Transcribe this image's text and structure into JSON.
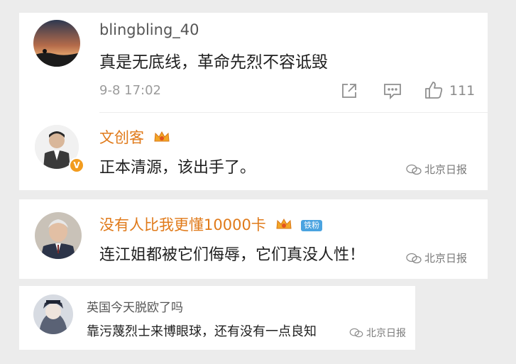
{
  "comments": [
    {
      "username": "blingbling_40",
      "text": "真是无底线，革命先烈不容诋毁",
      "time": "9-8 17:02",
      "likes": "111"
    },
    {
      "username": "文创客",
      "text": "正本清源，该出手了。",
      "verified_badge": "V"
    },
    {
      "username": "没有人比我更懂10000卡",
      "badge": "铁粉",
      "text": "连江姐都被它们侮辱，它们真没人性！"
    },
    {
      "username": "英国今天脱欧了吗",
      "text": "靠污蔑烈士来博眼球，还有没有一点良知"
    }
  ],
  "watermark": "北京日报",
  "icons": {
    "share": "share-icon",
    "comment": "comment-icon",
    "like": "thumbs-up-icon",
    "crown": "crown-badge-icon",
    "watermark": "wechat-icon"
  },
  "colors": {
    "vip_name": "#e07a1a",
    "normal_name": "#555555",
    "meta": "#9b9b9b",
    "fan_badge": "#4aa3e0"
  }
}
